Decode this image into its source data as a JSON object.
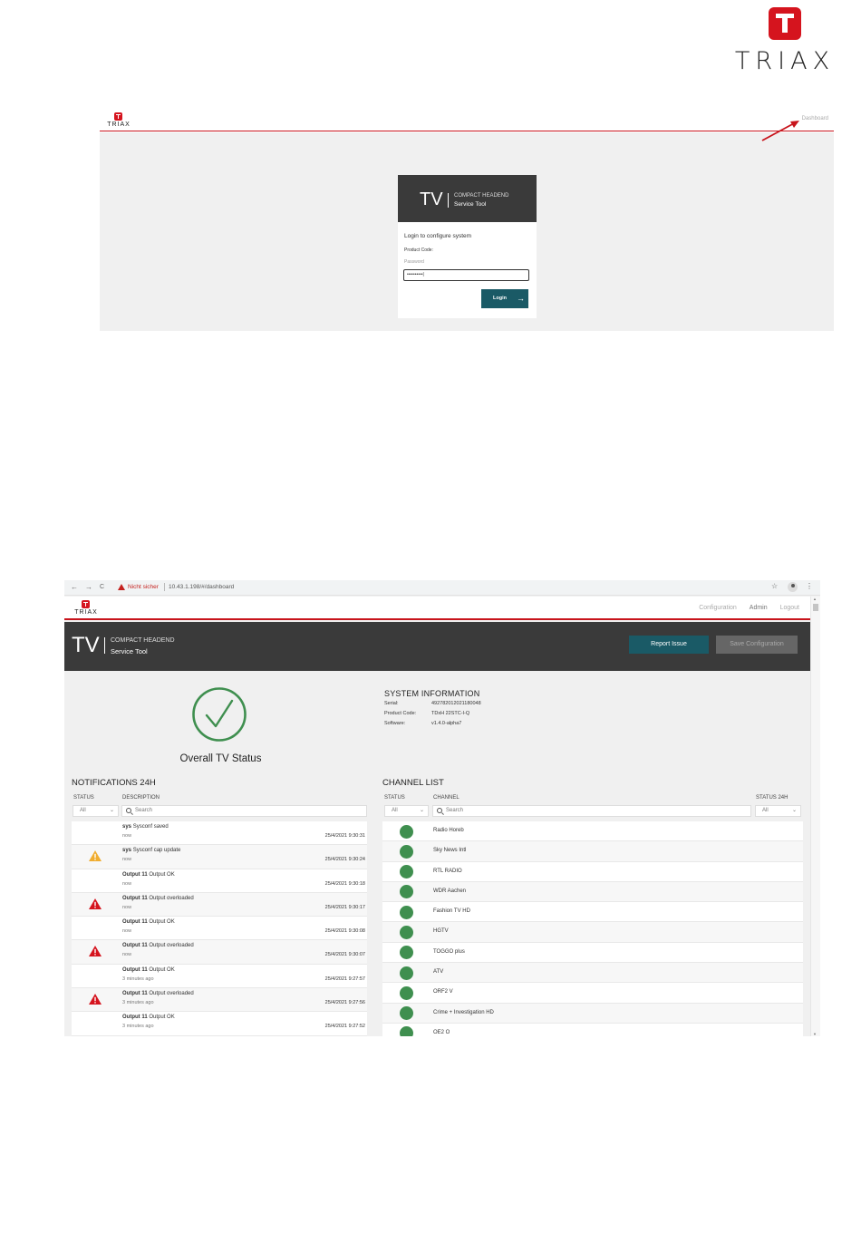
{
  "brand": {
    "name": "TRIAX",
    "red": "#d5141e",
    "dark": "#3a3a3a",
    "teal": "#1a5a66",
    "green": "#3f8f4f"
  },
  "login": {
    "nav_link": "Dashboard",
    "tv": "TV",
    "headline1": "COMPACT HEADEND",
    "headline2": "Service Tool",
    "prompt": "Login to configure system",
    "product_code_label": "Product Code:",
    "password_placeholder": "Password",
    "password_value": "••••••••••|",
    "login_button": "Login",
    "login_icon": "arrow-right-icon"
  },
  "browser": {
    "back": "←",
    "forward": "→",
    "reload": "C",
    "not_secure": "Nicht sicher",
    "url": "10.43.1.198/#/dashboard",
    "star": "☆",
    "menu": "⋮"
  },
  "app": {
    "nav": [
      "Configuration",
      "Admin",
      "Logout"
    ],
    "tv": "TV",
    "headline1": "COMPACT HEADEND",
    "headline2": "Service Tool",
    "report_issue": "Report Issue",
    "save_configuration": "Save Configuration"
  },
  "status": {
    "label": "Overall TV Status",
    "icon": "check-circle-icon",
    "color": "#3f8f4f"
  },
  "system_info": {
    "title": "SYSTEM INFORMATION",
    "rows": [
      {
        "key": "Serial:",
        "value": "492782012021180048"
      },
      {
        "key": "Product Code:",
        "value": "TDxH 22STC-I-Q"
      },
      {
        "key": "Software:",
        "value": "v1.4.0-alpha7"
      }
    ]
  },
  "notifications": {
    "title": "NOTIFICATIONS 24H",
    "col_status": "STATUS",
    "col_description": "DESCRIPTION",
    "filter": "All",
    "search_placeholder": "Search",
    "rows": [
      {
        "icon": "",
        "bold": "sys",
        "text": "Sysconf saved",
        "age": "now",
        "time": "25/4/2021 9:30:31"
      },
      {
        "icon": "warning",
        "bold": "sys",
        "text": "Sysconf cap update",
        "age": "now",
        "time": "25/4/2021 9:30:24"
      },
      {
        "icon": "",
        "bold": "Output 11",
        "text": "Output OK",
        "age": "now",
        "time": "25/4/2021 9:30:18"
      },
      {
        "icon": "error",
        "bold": "Output 11",
        "text": "Output overloaded",
        "age": "now",
        "time": "25/4/2021 9:30:17"
      },
      {
        "icon": "",
        "bold": "Output 11",
        "text": "Output OK",
        "age": "now",
        "time": "25/4/2021 9:30:08"
      },
      {
        "icon": "error",
        "bold": "Output 11",
        "text": "Output overloaded",
        "age": "now",
        "time": "25/4/2021 9:30:07"
      },
      {
        "icon": "",
        "bold": "Output 11",
        "text": "Output OK",
        "age": "3 minutes ago",
        "time": "25/4/2021 9:27:57"
      },
      {
        "icon": "error",
        "bold": "Output 11",
        "text": "Output overloaded",
        "age": "3 minutes ago",
        "time": "25/4/2021 9:27:56"
      },
      {
        "icon": "",
        "bold": "Output 11",
        "text": "Output OK",
        "age": "3 minutes ago",
        "time": "25/4/2021 9:27:52"
      }
    ]
  },
  "channels": {
    "title": "CHANNEL LIST",
    "col_status": "STATUS",
    "col_channel": "CHANNEL",
    "col_status24": "STATUS 24H",
    "filter": "All",
    "filter24": "All",
    "search_placeholder": "Search",
    "rows": [
      "Radio Horeb",
      "Sky News Intl",
      "RTL RADIO",
      "WDR Aachen",
      "Fashion TV HD",
      "HGTV",
      "TOGGO plus",
      "ATV",
      "ORF2 V",
      "Crime + Investigation HD",
      "OE2 O"
    ]
  }
}
